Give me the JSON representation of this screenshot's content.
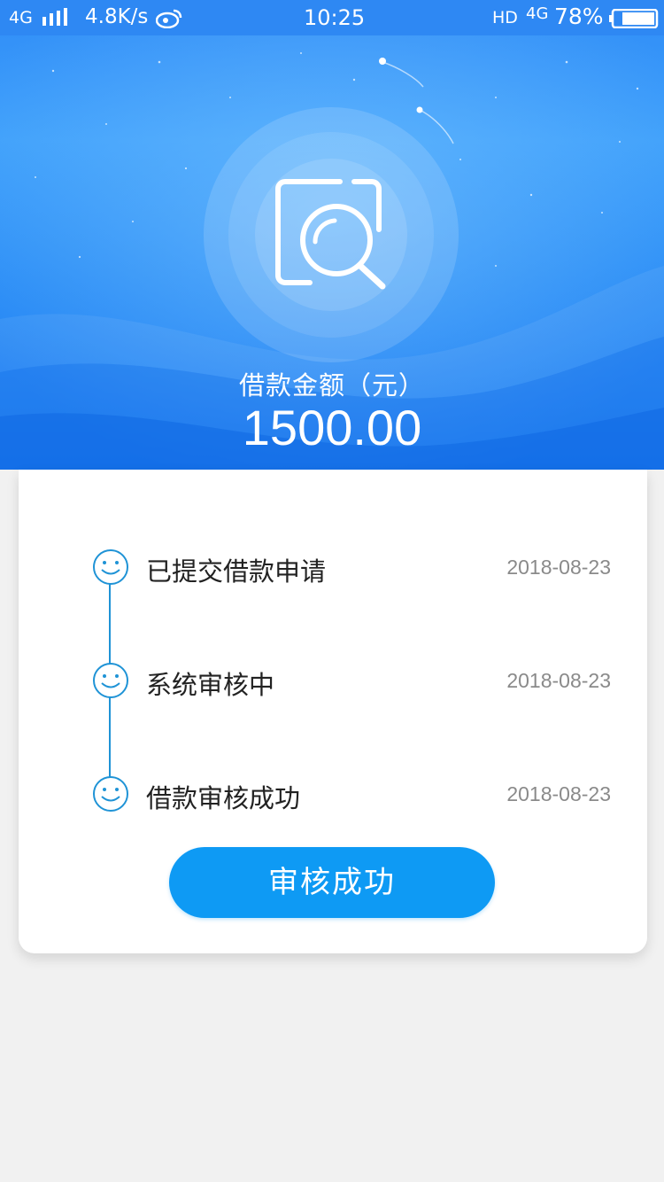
{
  "status_bar": {
    "network": "4G",
    "speed": "4.8K/s",
    "time": "10:25",
    "hd": "HD",
    "network2": "4G",
    "battery": "78%"
  },
  "header": {
    "icon": "search-document-icon",
    "amount_label": "借款金额（元）",
    "amount_value": "1500.00"
  },
  "timeline": {
    "steps": [
      {
        "label": "已提交借款申请",
        "date": "2018-08-23",
        "icon": "smile-icon"
      },
      {
        "label": "系统审核中",
        "date": "2018-08-23",
        "icon": "smile-icon"
      },
      {
        "label": "借款审核成功",
        "date": "2018-08-23",
        "icon": "smile-icon"
      }
    ]
  },
  "action": {
    "button_label": "审核成功"
  },
  "colors": {
    "header_blue": "#2b8df6",
    "accent": "#0e9af4",
    "timeline": "#1f93d6",
    "date_text": "#8a8a8a"
  }
}
